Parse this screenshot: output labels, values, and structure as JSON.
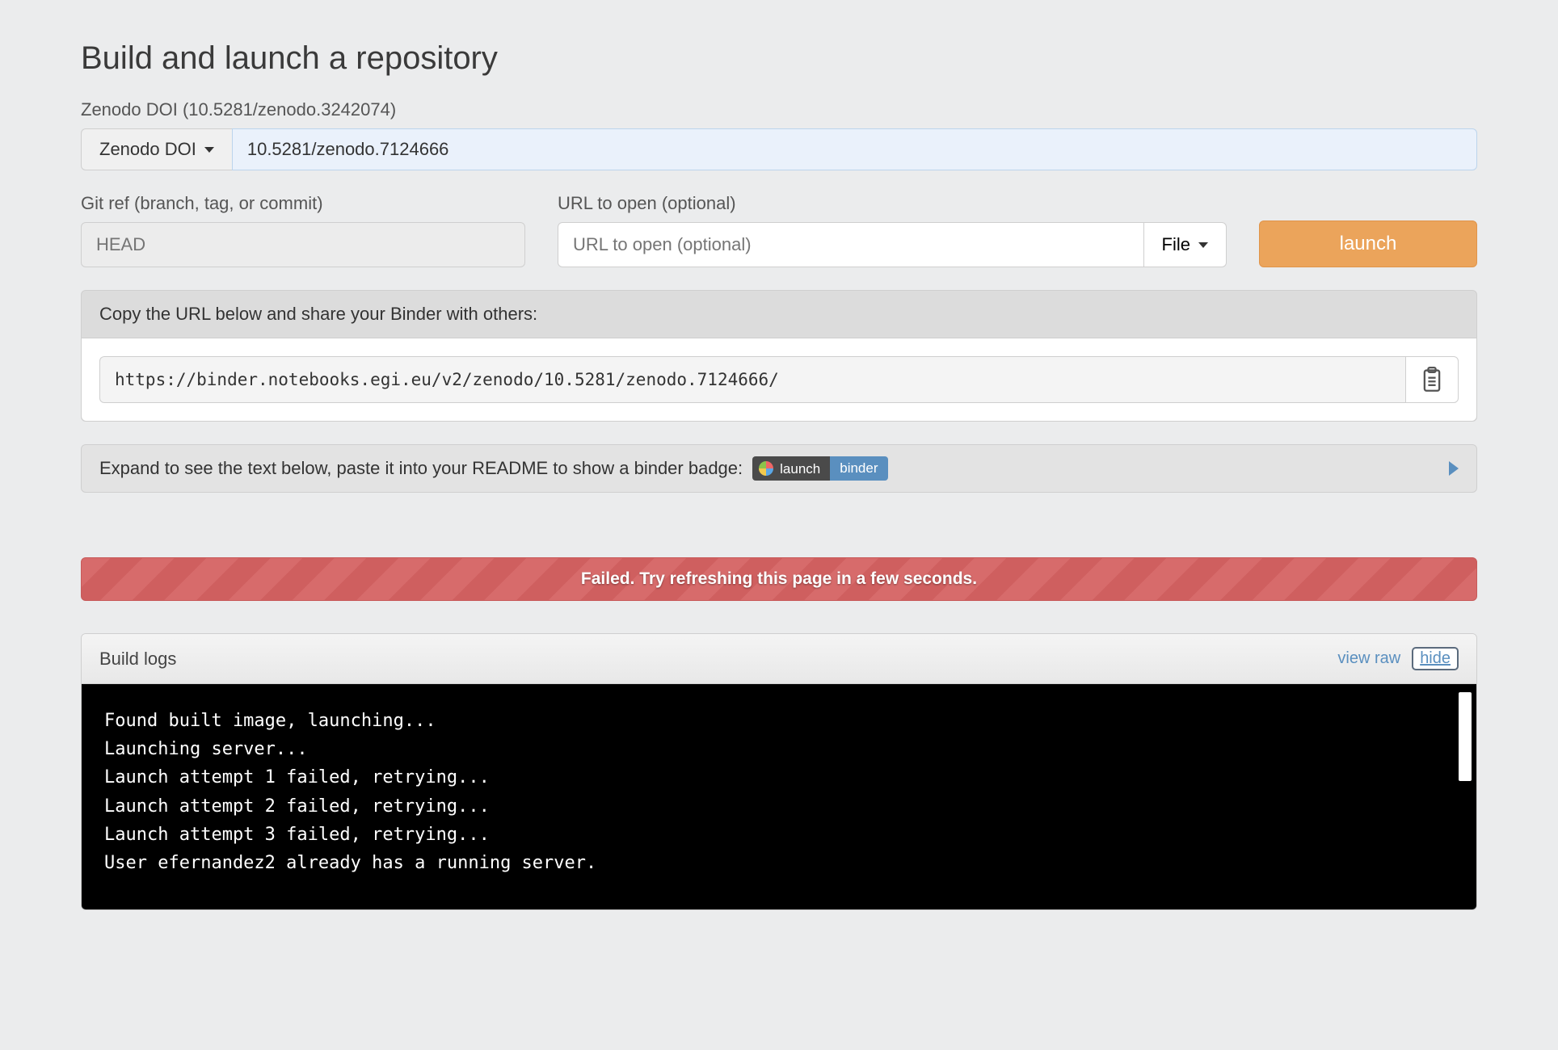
{
  "header": {
    "title": "Build and launch a repository"
  },
  "provider": {
    "label": "Zenodo DOI (10.5281/zenodo.3242074)",
    "dropdown_label": "Zenodo DOI",
    "input_value": "10.5281/zenodo.7124666"
  },
  "ref": {
    "label": "Git ref (branch, tag, or commit)",
    "placeholder": "HEAD",
    "value": ""
  },
  "urlpath": {
    "label": "URL to open (optional)",
    "placeholder": "URL to open (optional)",
    "value": "",
    "type_label": "File"
  },
  "launch": {
    "button_label": "launch"
  },
  "share": {
    "header": "Copy the URL below and share your Binder with others:",
    "url": "https://binder.notebooks.egi.eu/v2/zenodo/10.5281/zenodo.7124666/"
  },
  "badge_panel": {
    "text": "Expand to see the text below, paste it into your README to show a binder badge:",
    "badge_left": "launch",
    "badge_right": "binder"
  },
  "error": {
    "message": "Failed. Try refreshing this page in a few seconds."
  },
  "logs": {
    "title": "Build logs",
    "view_raw": "view raw",
    "hide": "hide",
    "lines": "Found built image, launching...\nLaunching server...\nLaunch attempt 1 failed, retrying...\nLaunch attempt 2 failed, retrying...\nLaunch attempt 3 failed, retrying...\nUser efernandez2 already has a running server."
  }
}
